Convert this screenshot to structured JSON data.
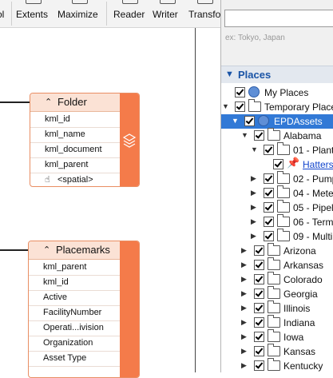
{
  "toolbar": {
    "buttons": [
      {
        "label": "ol"
      },
      {
        "label": "Extents"
      },
      {
        "label": "Maximize"
      },
      {
        "label": "Reader"
      },
      {
        "label": "Writer"
      },
      {
        "label": "Transfo"
      }
    ]
  },
  "canvas": {
    "nodes": [
      {
        "title": "Folder",
        "rows": [
          "kml_id",
          "kml_name",
          "kml_document",
          "kml_parent",
          "<spatial>"
        ]
      },
      {
        "title": "Placemarks",
        "rows": [
          "kml_parent",
          "kml_id",
          "Active",
          "FacilityNumber",
          "Operati...ivision",
          "Organization",
          "Asset Type"
        ]
      }
    ]
  },
  "panel": {
    "search": {
      "value": "",
      "hint": "ex: Tokyo, Japan"
    },
    "places_title": "Places",
    "tree": [
      {
        "label": "My Places"
      },
      {
        "label": "Temporary Places"
      },
      {
        "label": "EPDAssets"
      },
      {
        "label": "Alabama"
      },
      {
        "label": "01 - Plant"
      },
      {
        "label": "Hatters"
      },
      {
        "label": "02 - Pump"
      },
      {
        "label": "04 - Mete"
      },
      {
        "label": "05 - Pipeli"
      },
      {
        "label": "06 - Termi"
      },
      {
        "label": "09 - Multi"
      },
      {
        "label": "Arizona"
      },
      {
        "label": "Arkansas"
      },
      {
        "label": "Colorado"
      },
      {
        "label": "Georgia"
      },
      {
        "label": "Illinois"
      },
      {
        "label": "Indiana"
      },
      {
        "label": "Iowa"
      },
      {
        "label": "Kansas"
      },
      {
        "label": "Kentucky"
      }
    ]
  },
  "colors": {
    "node_accent": "#f47b4a",
    "node_header": "#fbe2d5",
    "selection": "#3179d6",
    "places_title": "#1a54a6"
  }
}
